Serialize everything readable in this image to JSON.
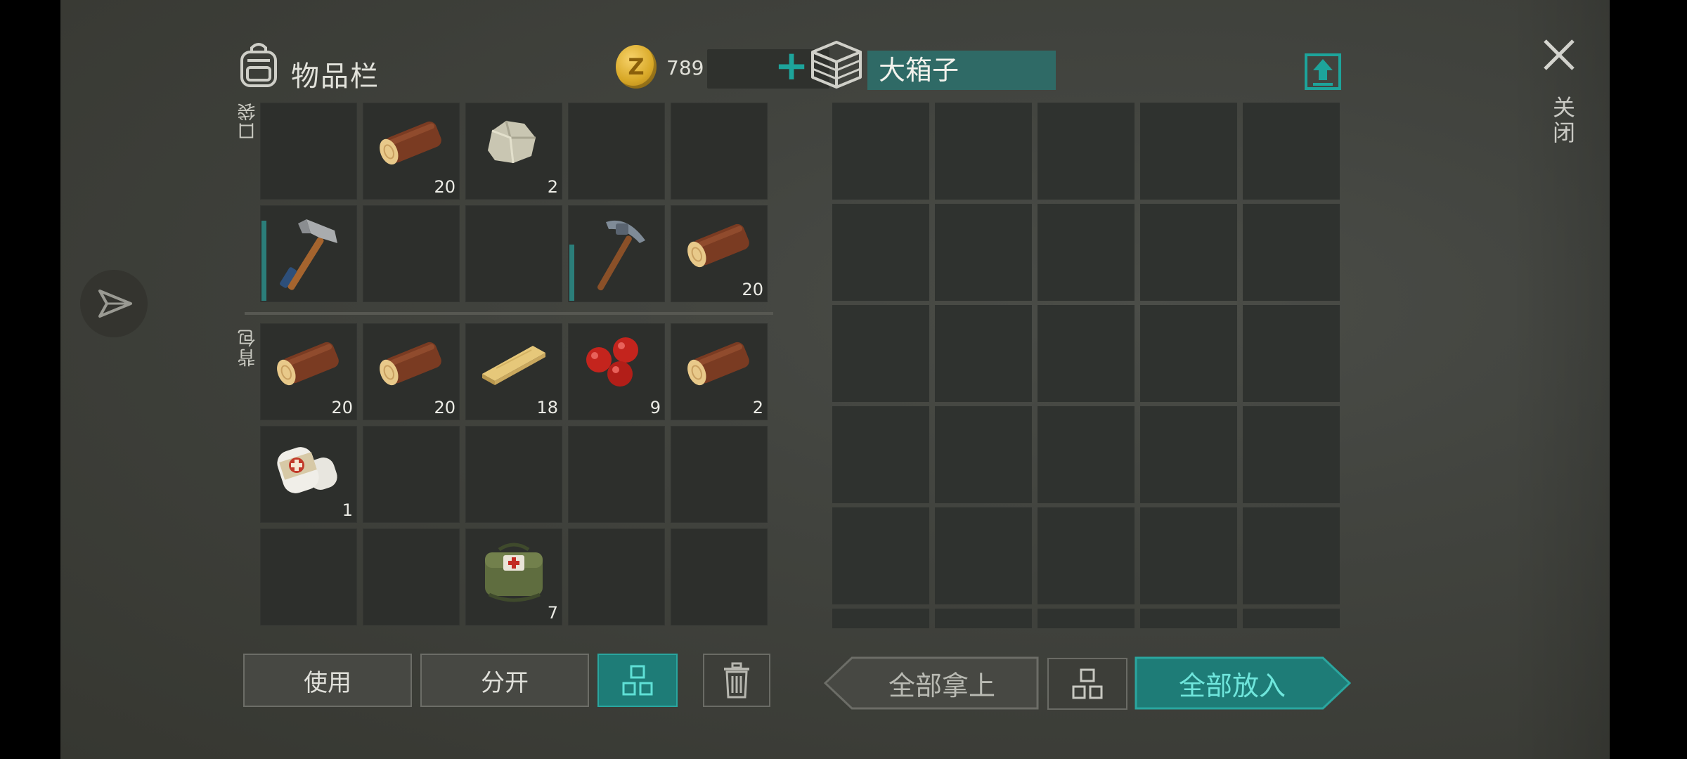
{
  "inventory": {
    "title": "物品栏",
    "currency": {
      "amount": "789",
      "coin_letter": "Z"
    },
    "pocket_label": "口袋",
    "backpack_label": "背包",
    "pocket_slots": [
      {
        "item": ""
      },
      {
        "item": "log",
        "count": "20"
      },
      {
        "item": "stone",
        "count": "2"
      },
      {
        "item": ""
      },
      {
        "item": ""
      },
      {
        "item": "axe",
        "durability": 0.85
      },
      {
        "item": ""
      },
      {
        "item": ""
      },
      {
        "item": "pickaxe",
        "durability": 0.6
      },
      {
        "item": "log",
        "count": "20"
      }
    ],
    "backpack_slots": [
      {
        "item": "log",
        "count": "20"
      },
      {
        "item": "log",
        "count": "20"
      },
      {
        "item": "plank",
        "count": "18"
      },
      {
        "item": "berries",
        "count": "9"
      },
      {
        "item": "log",
        "count": "2"
      },
      {
        "item": "bandage",
        "count": "1"
      },
      {
        "item": ""
      },
      {
        "item": ""
      },
      {
        "item": ""
      },
      {
        "item": ""
      },
      {
        "item": ""
      },
      {
        "item": ""
      },
      {
        "item": "first-aid-kit",
        "count": "7"
      },
      {
        "item": ""
      },
      {
        "item": ""
      }
    ],
    "buttons": {
      "use": "使用",
      "split": "分开"
    }
  },
  "chest": {
    "name": "大箱子",
    "buttons": {
      "take_all": "全部拿上",
      "put_all": "全部放入"
    }
  },
  "close_label": "关闭",
  "colors": {
    "accent": "#1e7c77",
    "accent_bright": "#1da49b",
    "slot": "#2d2f2c"
  }
}
